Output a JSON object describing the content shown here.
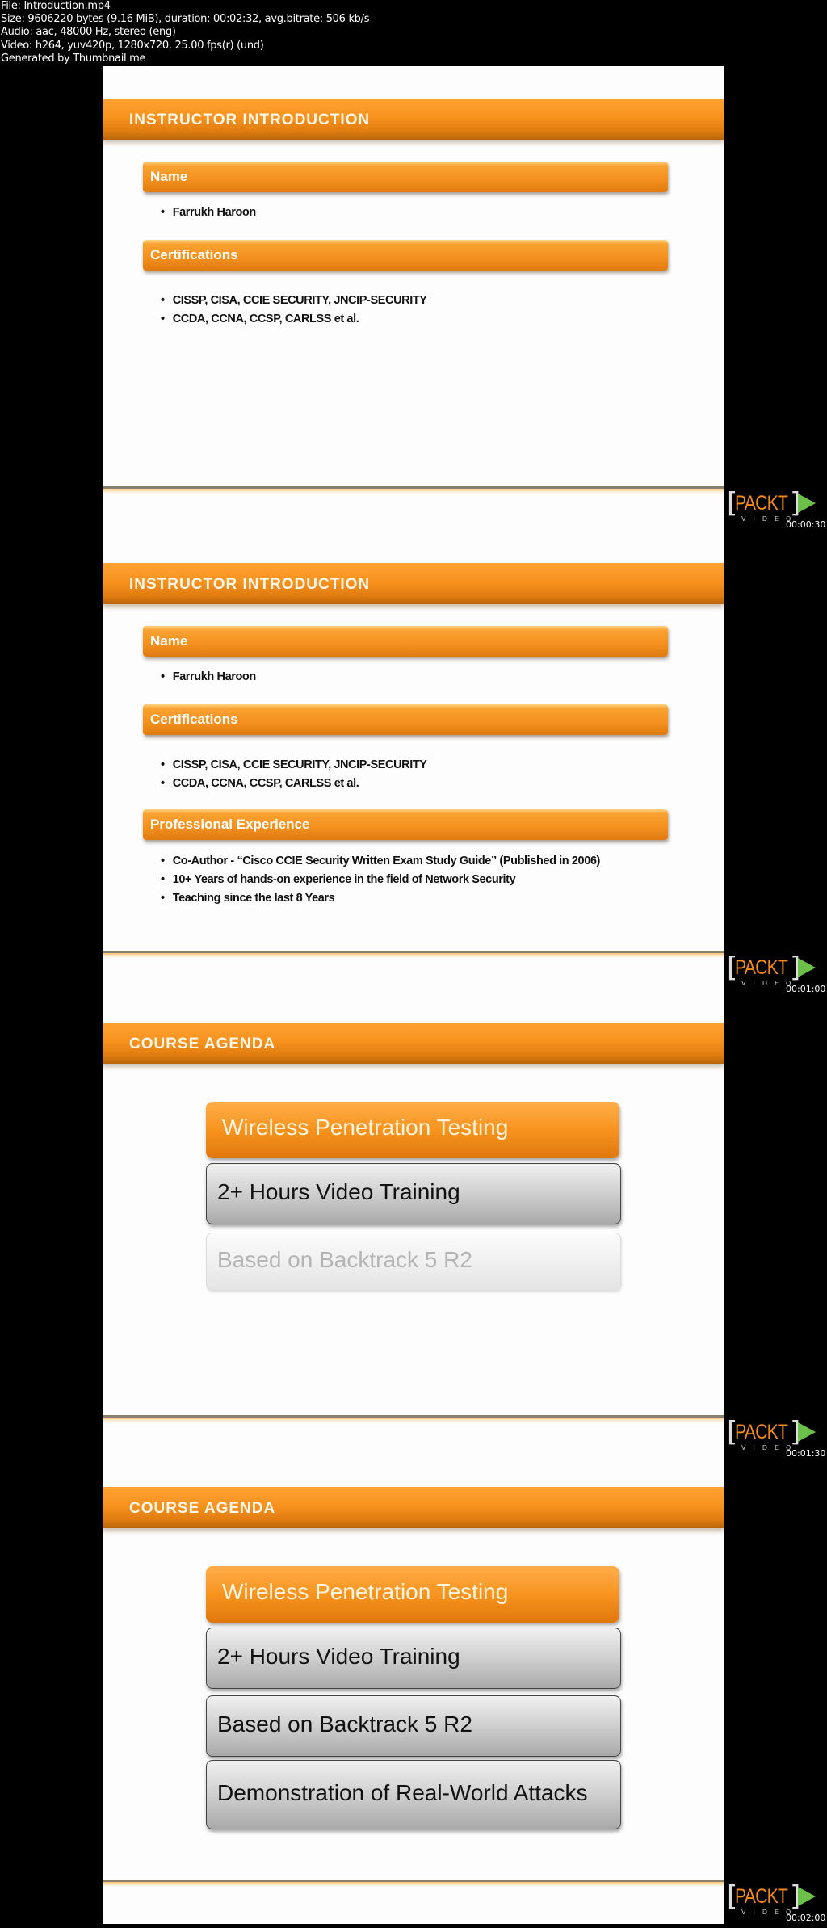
{
  "file_info": {
    "file": "File: Introduction.mp4",
    "size": "Size: 9606220 bytes (9.16 MiB), duration: 00:02:32, avg.bitrate: 506 kb/s",
    "audio": "Audio: aac, 48000 Hz, stereo (eng)",
    "video": "Video: h264, yuv420p, 1280x720, 25.00 fps(r) (und)",
    "generator": "Generated by Thumbnail me"
  },
  "brand": {
    "bracket_open": "[",
    "name": "PACKT",
    "bracket_close": "]",
    "subtitle": "VIDEO",
    "accent": "#f7941e",
    "play_color": "#6cc04a"
  },
  "frames": [
    {
      "timestamp": "00:00:30",
      "title": "INSTRUCTOR INTRODUCTION",
      "sections": [
        {
          "label": "Name",
          "items": [
            "Farrukh Haroon"
          ]
        },
        {
          "label": "Certifications",
          "items": [
            "CISSP, CISA, CCIE SECURITY, JNCIP-SECURITY",
            "CCDA, CCNA, CCSP, CARLSS et al."
          ]
        }
      ]
    },
    {
      "timestamp": "00:01:00",
      "title": "INSTRUCTOR INTRODUCTION",
      "sections": [
        {
          "label": "Name",
          "items": [
            "Farrukh Haroon"
          ]
        },
        {
          "label": "Certifications",
          "items": [
            "CISSP, CISA, CCIE SECURITY, JNCIP-SECURITY",
            "CCDA, CCNA, CCSP, CARLSS et al."
          ]
        },
        {
          "label": "Professional Experience",
          "items": [
            "Co-Author - “Cisco CCIE Security Written Exam Study Guide” (Published in 2006)",
            "10+ Years of hands-on  experience  in the field of Network Security",
            "Teaching since the last 8 Years"
          ]
        }
      ]
    },
    {
      "timestamp": "00:01:30",
      "title": "COURSE AGENDA",
      "agenda": [
        {
          "label": "Wireless Penetration Testing",
          "style": "highlight"
        },
        {
          "label": "2+ Hours Video Training",
          "style": "normal"
        },
        {
          "label": "Based on Backtrack 5 R2",
          "style": "faded"
        }
      ]
    },
    {
      "timestamp": "00:02:00",
      "title": "COURSE AGENDA",
      "agenda": [
        {
          "label": "Wireless Penetration Testing",
          "style": "highlight"
        },
        {
          "label": "2+ Hours Video Training",
          "style": "normal"
        },
        {
          "label": "Based on Backtrack 5 R2",
          "style": "normal"
        },
        {
          "label": "Demonstration of Real-World Attacks",
          "style": "normal"
        }
      ]
    }
  ]
}
